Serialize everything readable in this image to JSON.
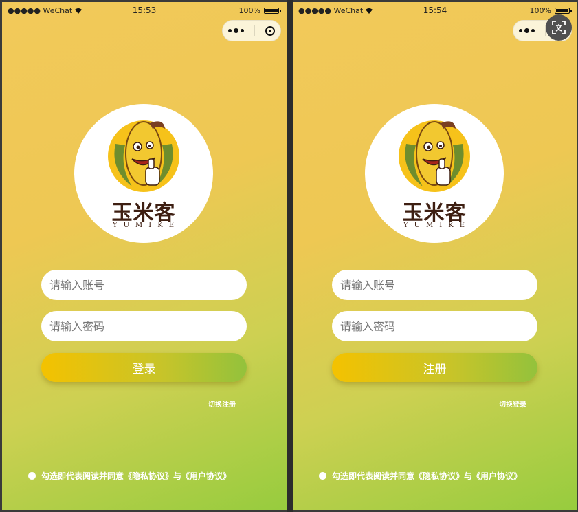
{
  "colors": {
    "background_top": "#f2c95a",
    "background_bottom": "#97cc3e",
    "button_start": "#f4c200",
    "button_end": "#93c23c",
    "brand_text": "#3e1f12"
  },
  "screens": [
    {
      "status": {
        "carrier": "●●●●● WeChat",
        "time": "15:53",
        "battery": "100%"
      },
      "logo": {
        "cn": "玉米客",
        "en": "YUMIKE"
      },
      "account": {
        "placeholder": "请输入账号",
        "value": ""
      },
      "password": {
        "placeholder": "请输入密码",
        "value": ""
      },
      "primary_button": "登录",
      "switch_link": "切换注册",
      "agreement": "勾选即代表阅读并同意《隐私协议》与《用户协议》",
      "icons": [
        "wifi-icon",
        "battery-icon",
        "more-icon",
        "close-icon",
        "radio-icon"
      ]
    },
    {
      "status": {
        "carrier": "●●●●● WeChat",
        "time": "15:54",
        "battery": "100%"
      },
      "logo": {
        "cn": "玉米客",
        "en": "YUMIKE"
      },
      "account": {
        "placeholder": "请输入账号",
        "value": ""
      },
      "password": {
        "placeholder": "请输入密码",
        "value": ""
      },
      "primary_button": "注册",
      "switch_link": "切换登录",
      "agreement": "勾选即代表阅读并同意《隐私协议》与《用户协议》",
      "icons": [
        "wifi-icon",
        "battery-icon",
        "more-icon",
        "close-icon",
        "translate-icon",
        "radio-icon"
      ]
    }
  ]
}
